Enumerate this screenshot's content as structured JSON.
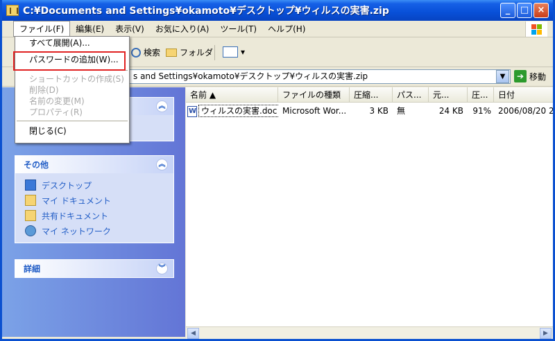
{
  "window": {
    "title": "C:¥Documents and Settings¥okamoto¥デスクトップ¥ウィルスの実害.zip",
    "min_label": "_",
    "max_label": "□",
    "close_label": "×"
  },
  "menubar": {
    "items": [
      "ファイル(F)",
      "編集(E)",
      "表示(V)",
      "お気に入り(A)",
      "ツール(T)",
      "ヘルプ(H)"
    ]
  },
  "toolbar": {
    "search_label": "検索",
    "folders_label": "フォルダ",
    "views_dropdown": "▾"
  },
  "address": {
    "value": "s and Settings¥okamoto¥デスクトップ¥ウィルスの実害.zip",
    "go_label": "移動"
  },
  "file_menu": {
    "items": [
      {
        "label": "すべて展開(A)...",
        "enabled": true
      },
      {
        "label": "パスワードの追加(W)...",
        "enabled": true,
        "highlighted": true
      },
      {
        "label": "ショートカットの作成(S)",
        "enabled": false
      },
      {
        "label": "削除(D)",
        "enabled": false
      },
      {
        "label": "名前の変更(M)",
        "enabled": false
      },
      {
        "label": "プロパティ(R)",
        "enabled": false
      },
      {
        "label": "閉じる(C)",
        "enabled": true
      }
    ]
  },
  "taskpane": {
    "other_places": {
      "title": "その他",
      "items": [
        "デスクトップ",
        "マイ ドキュメント",
        "共有ドキュメント",
        "マイ ネットワーク"
      ]
    },
    "details": {
      "title": "詳細"
    }
  },
  "filelist": {
    "columns": [
      "名前 ▲",
      "ファイルの種類",
      "圧縮...",
      "パス...",
      "元...",
      "圧...",
      "日付"
    ],
    "rows": [
      {
        "name": "ウィルスの実害.doc",
        "type": "Microsoft Wor...",
        "packed": "3 KB",
        "password": "無",
        "size": "24 KB",
        "ratio": "91%",
        "date": "2006/08/20 2"
      }
    ]
  },
  "colors": {
    "titlebar": "#0850d8",
    "highlight_box": "#e02020",
    "link": "#215dc6"
  }
}
